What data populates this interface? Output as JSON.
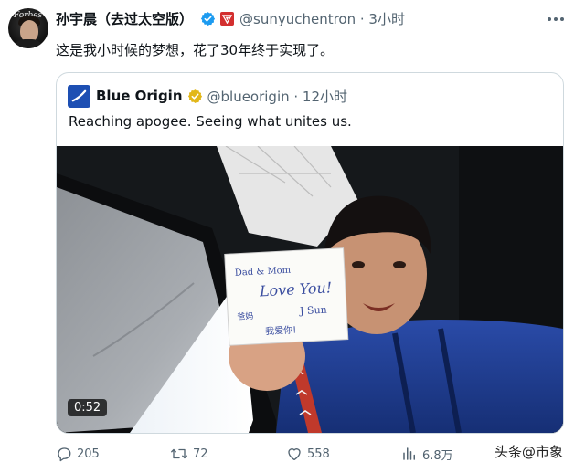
{
  "tweet": {
    "author_name": "孙宇晨（去过太空版）",
    "handle_time": "@sunyuchentron · 3小时",
    "text": "这是我小时候的梦想，花了30年终于实现了。",
    "avatar_text": "Forbes"
  },
  "quote": {
    "author_name": "Blue Origin",
    "handle_time": "@blueorigin · 12小时",
    "text": "Reaching apogee. Seeing what unites us.",
    "video_duration": "0:52",
    "note_text": {
      "line1": "Dad & Mom",
      "line2": "Love You!",
      "line3": "J Sun",
      "line4": "爸妈",
      "line5": "我爱你!"
    }
  },
  "actions": {
    "replies": "205",
    "retweets": "72",
    "likes": "558",
    "views": "6.8万"
  },
  "watermark": "头条@市象",
  "colors": {
    "text_primary": "#0f1419",
    "text_secondary": "#536471",
    "verified_blue": "#1d9bf0",
    "verified_gold": "#e2b719",
    "border": "#cfd9de",
    "blue_origin": "#1d4fb3"
  },
  "icons": {
    "verified": "verified-badge-icon",
    "affiliate": "affiliate-badge-icon",
    "more": "more-icon",
    "reply": "reply-icon",
    "retweet": "retweet-icon",
    "like": "heart-icon",
    "views": "views-icon"
  }
}
